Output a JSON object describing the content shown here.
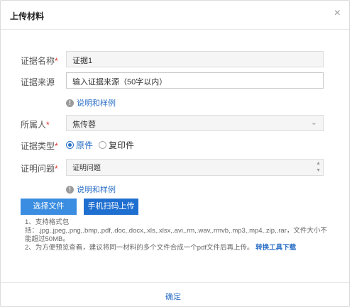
{
  "dialog": {
    "title": "上传材料",
    "close_glyph": "×"
  },
  "form": {
    "evidence_name": {
      "label": "证据名称",
      "required_mark": "*",
      "value": "证据1"
    },
    "evidence_source": {
      "label": "证据来源",
      "placeholder": "输入证据来源（50字以内）"
    },
    "hint1": {
      "icon": "info-icon",
      "text": "说明和样例"
    },
    "owner": {
      "label": "所属人",
      "required_mark": "*",
      "value": "焦传蓉",
      "chevron": "⌄"
    },
    "evidence_type": {
      "label": "证据类型",
      "required_mark": "*",
      "options": [
        {
          "label": "原件",
          "selected": true
        },
        {
          "label": "复印件",
          "selected": false
        }
      ]
    },
    "proof_issue": {
      "label": "证明问题",
      "required_mark": "*",
      "value": "证明问题",
      "spin_up": "▲",
      "spin_down": "▼"
    },
    "hint2": {
      "icon": "info-icon",
      "text": "说明和样例"
    }
  },
  "buttons": {
    "choose_file": "选择文件",
    "phone_scan": "手机扫码上传"
  },
  "notes": {
    "line1": "1、支持格式包",
    "line2": "括：.jpg,.jpeg,.png,.bmp,.pdf,.doc,.docx,.xls,.xlsx,.avi,.rm,.wav,.rmvb,.mp3,.mp4,.zip,.rar，文件大小不",
    "line3": "能超过50MB。",
    "line4": "2、为方便预览查看，建议将同一材料的多个文件合成一个pdf文件后再上传。",
    "tool_link": "转换工具下载"
  },
  "footer": {
    "confirm": "确定"
  },
  "colors": {
    "accent": "#2b6fc6",
    "required": "#e0322b",
    "button": "#3a8de0"
  }
}
